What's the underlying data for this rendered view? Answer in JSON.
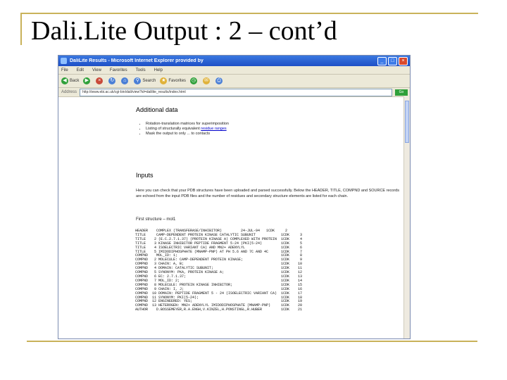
{
  "slide": {
    "title": "Dali.Lite Output : 2 – cont’d"
  },
  "browser": {
    "title": "DaliLite Results - Microsoft Internet Explorer provided by",
    "menu": [
      "File",
      "Edit",
      "View",
      "Favorites",
      "Tools",
      "Help"
    ],
    "toolbar": {
      "back": "Back",
      "search": "Search",
      "favorites": "Favorites"
    },
    "address_label": "Address",
    "address": "http://www.ebi.ac.uk/cgi-bin/dali/view?id=dalilite_results/index.html",
    "go": "Go"
  },
  "page": {
    "additional_heading": "Additional data",
    "bullets": [
      {
        "text": "Rotation-translation matrices for superimposition",
        "link": ""
      },
      {
        "text": "Listing of structurally equivalent ",
        "link": "residue ranges"
      },
      {
        "text": "Mask the output to only ... to contacts",
        "link": ""
      }
    ],
    "inputs_heading": "Inputs",
    "inputs_text": "Here you can check that your PDB structures have been uploaded and parsed successfully. Below the HEADER, TITLE, COMPND and SOURCE records are echoed from the input PDB files and the number of residues and secondary structure elements are listed for each chain.",
    "first_structure_label": "First structure – mol1",
    "pdb_lines": [
      "HEADER    COMPLEX (TRANSFERASE/INHIBITOR)         24-JUL-94   1CDK     2",
      "TITLE     CAMP-DEPENDENT PROTEIN KINASE CATALYTIC SUBUNIT            1CDK     3",
      "TITLE    2 (E.C.2.7.1.37) (PROTEIN KINASE A) COMPLEXED WITH PROTEIN  1CDK     4",
      "TITLE    3 KINASE INHIBITOR PEPTIDE FRAGMENT 5-24 (PKI(5-24)         1CDK     5",
      "TITLE    4 ISOELECTRIC VARIANT CA) AND MN2+ ADENYLYL                 1CDK     6",
      "TITLE    5 IMIDODIPHOSPHATE (MNAMP-PNP) AT PH 5.6 AND 7C AND 4C      1CDK     7",
      "COMPND    MOL_ID: 1;                                                 1CDK     8",
      "COMPND   2 MOLECULE: CAMP-DEPENDENT PROTEIN KINASE;                  1CDK     9",
      "COMPND   3 CHAIN: A, B;                                              1CDK    10",
      "COMPND   4 DOMAIN: CATALYTIC SUBUNIT;                                1CDK    11",
      "COMPND   5 SYNONYM: PKA, PROTEIN KINASE A;                           1CDK    12",
      "COMPND   6 EC: 2.7.1.37;                                             1CDK    13",
      "COMPND   7 MOL_ID: 2;                                                1CDK    14",
      "COMPND   8 MOLECULE: PROTEIN KINASE INHIBITOR;                       1CDK    15",
      "COMPND   9 CHAIN: I, J;                                              1CDK    16",
      "COMPND  10 DOMAIN: PEPTIDE FRAGMENT 5 - 24 (ISOELECTRIC VARIANT CA)  1CDK    17",
      "COMPND  11 SYNONYM: PKI(5-24);                                       1CDK    18",
      "COMPND  12 ENGINEERED: YES;                                          1CDK    19",
      "COMPND  13 HETEROGEN: MN2+ ADENYLYL IMIDODIPHOSPHATE (MNAMP-PNP)     1CDK    20",
      "AUTHOR    D.BOSSEMEYER,R.A.ENGH,V.KINZEL,H.PONSTINGL,R.HUBER         1CDK    21"
    ]
  }
}
